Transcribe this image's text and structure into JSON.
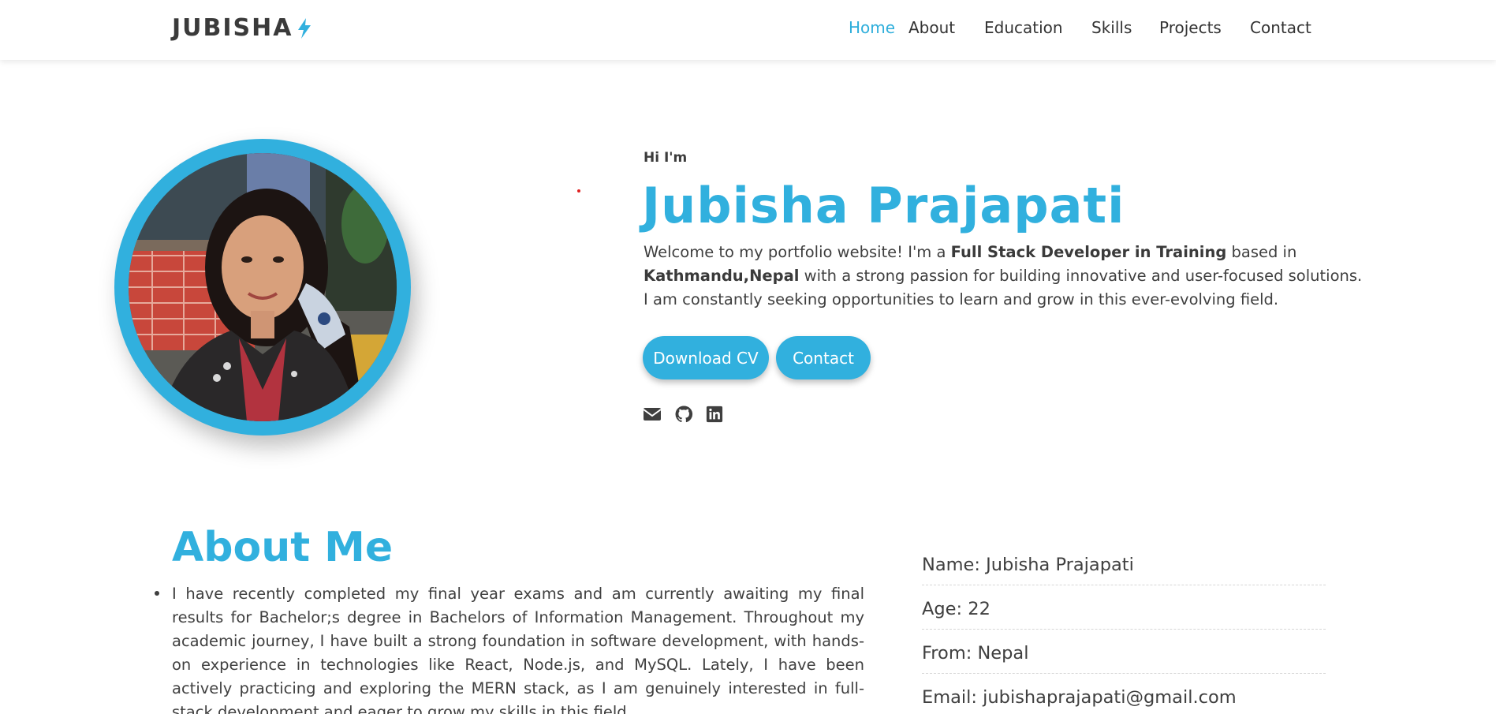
{
  "header": {
    "logo": "JUBISHA",
    "nav": [
      "Home",
      "About",
      "Education",
      "Skills",
      "Projects",
      "Contact"
    ],
    "active": "Home",
    "accent_color": "#31b0de"
  },
  "hero": {
    "greeting": "Hi I'm",
    "name": "Jubisha Prajapati",
    "intro_1": "Welcome to my portfolio website! I'm a ",
    "intro_bold_role": "Full Stack Developer in Training",
    "intro_2": " based in ",
    "intro_bold_location": "Kathmandu,Nepal",
    "intro_3": " with a strong passion for building innovative and user-focused solutions. I am constantly seeking opportunities to learn and grow in this ever-evolving field.",
    "buttons": {
      "cv": "Download CV",
      "contact": "Contact"
    },
    "social_icons": [
      "envelope-icon",
      "github-icon",
      "linkedin-icon"
    ]
  },
  "about": {
    "title": "About Me",
    "paragraph": "I have recently completed my final year exams and am currently awaiting my final results for Bachelor;s degree in Bachelors of Information Management. Throughout my academic journey, I have built a strong foundation in software development, with hands-on experience in technologies like React, Node.js, and MySQL. Lately, I have been actively practicing and exploring the MERN stack, as I am genuinely interested in full-stack development and eager to grow my skills in this field.",
    "info": [
      "Name: Jubisha Prajapati",
      "Age: 22",
      "From: Nepal",
      "Email: jubishaprajapati@gmail.com"
    ]
  }
}
